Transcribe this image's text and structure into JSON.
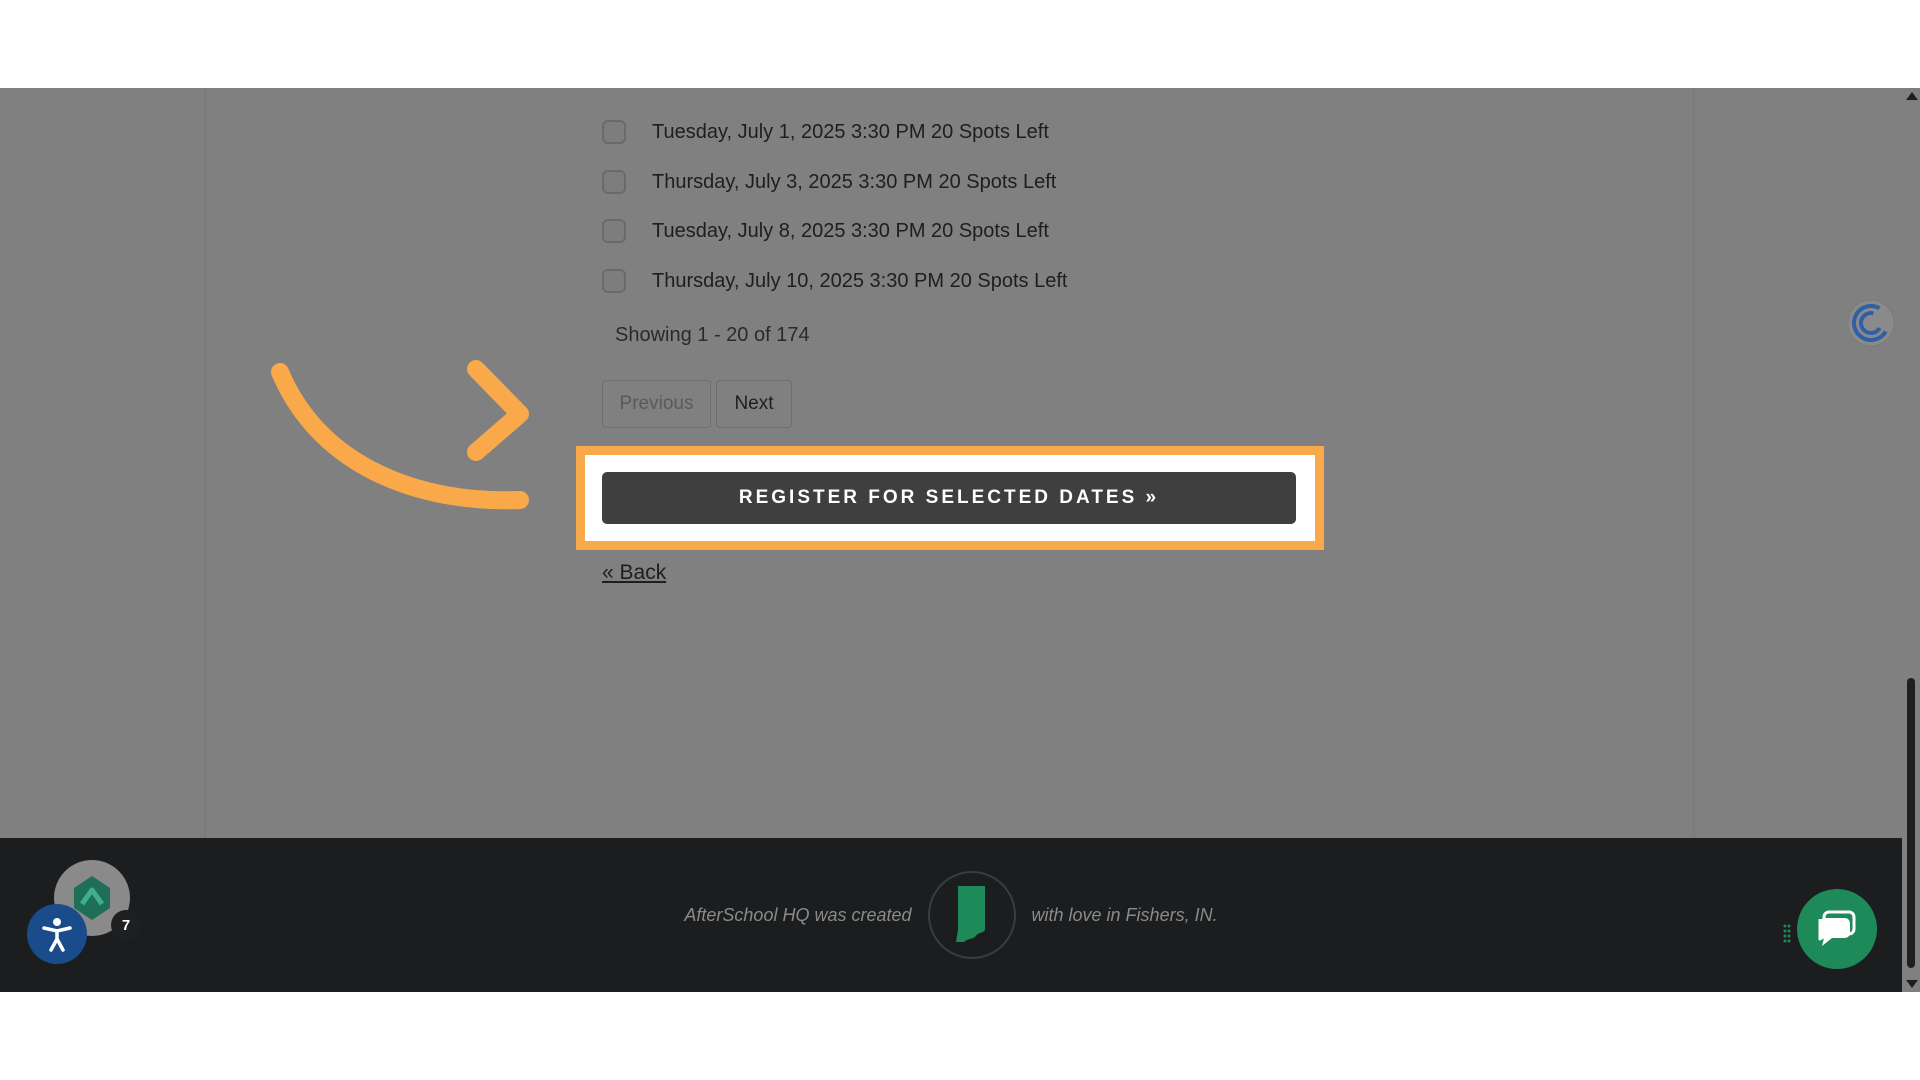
{
  "dates": [
    {
      "label": "Tuesday, July 1, 2025 3:30 PM 20 Spots Left"
    },
    {
      "label": "Thursday, July 3, 2025 3:30 PM 20 Spots Left"
    },
    {
      "label": "Tuesday, July 8, 2025 3:30 PM 20 Spots Left"
    },
    {
      "label": "Thursday, July 10, 2025 3:30 PM 20 Spots Left"
    }
  ],
  "pagination": {
    "showing": "Showing 1 - 20 of 174",
    "previous": "Previous",
    "next": "Next"
  },
  "actions": {
    "register": "REGISTER FOR SELECTED DATES »",
    "back": "« Back"
  },
  "footer": {
    "text_left": "AfterSchool HQ was created",
    "text_right": "with love in Fishers, IN."
  },
  "widgets": {
    "app_badge_count": "7"
  },
  "colors": {
    "overlay": "#808080",
    "highlight": "#f9a94a",
    "register_button": "#3f3f3f",
    "footer_bg": "#1b1d1f",
    "chat_button": "#1e8a5a",
    "accessibility_button": "#1a4c8c"
  },
  "icons": {
    "callout": "curved-arrow-icon",
    "accessibility": "accessibility-icon",
    "chat": "chat-bubble-icon",
    "state": "indiana-state-icon"
  }
}
